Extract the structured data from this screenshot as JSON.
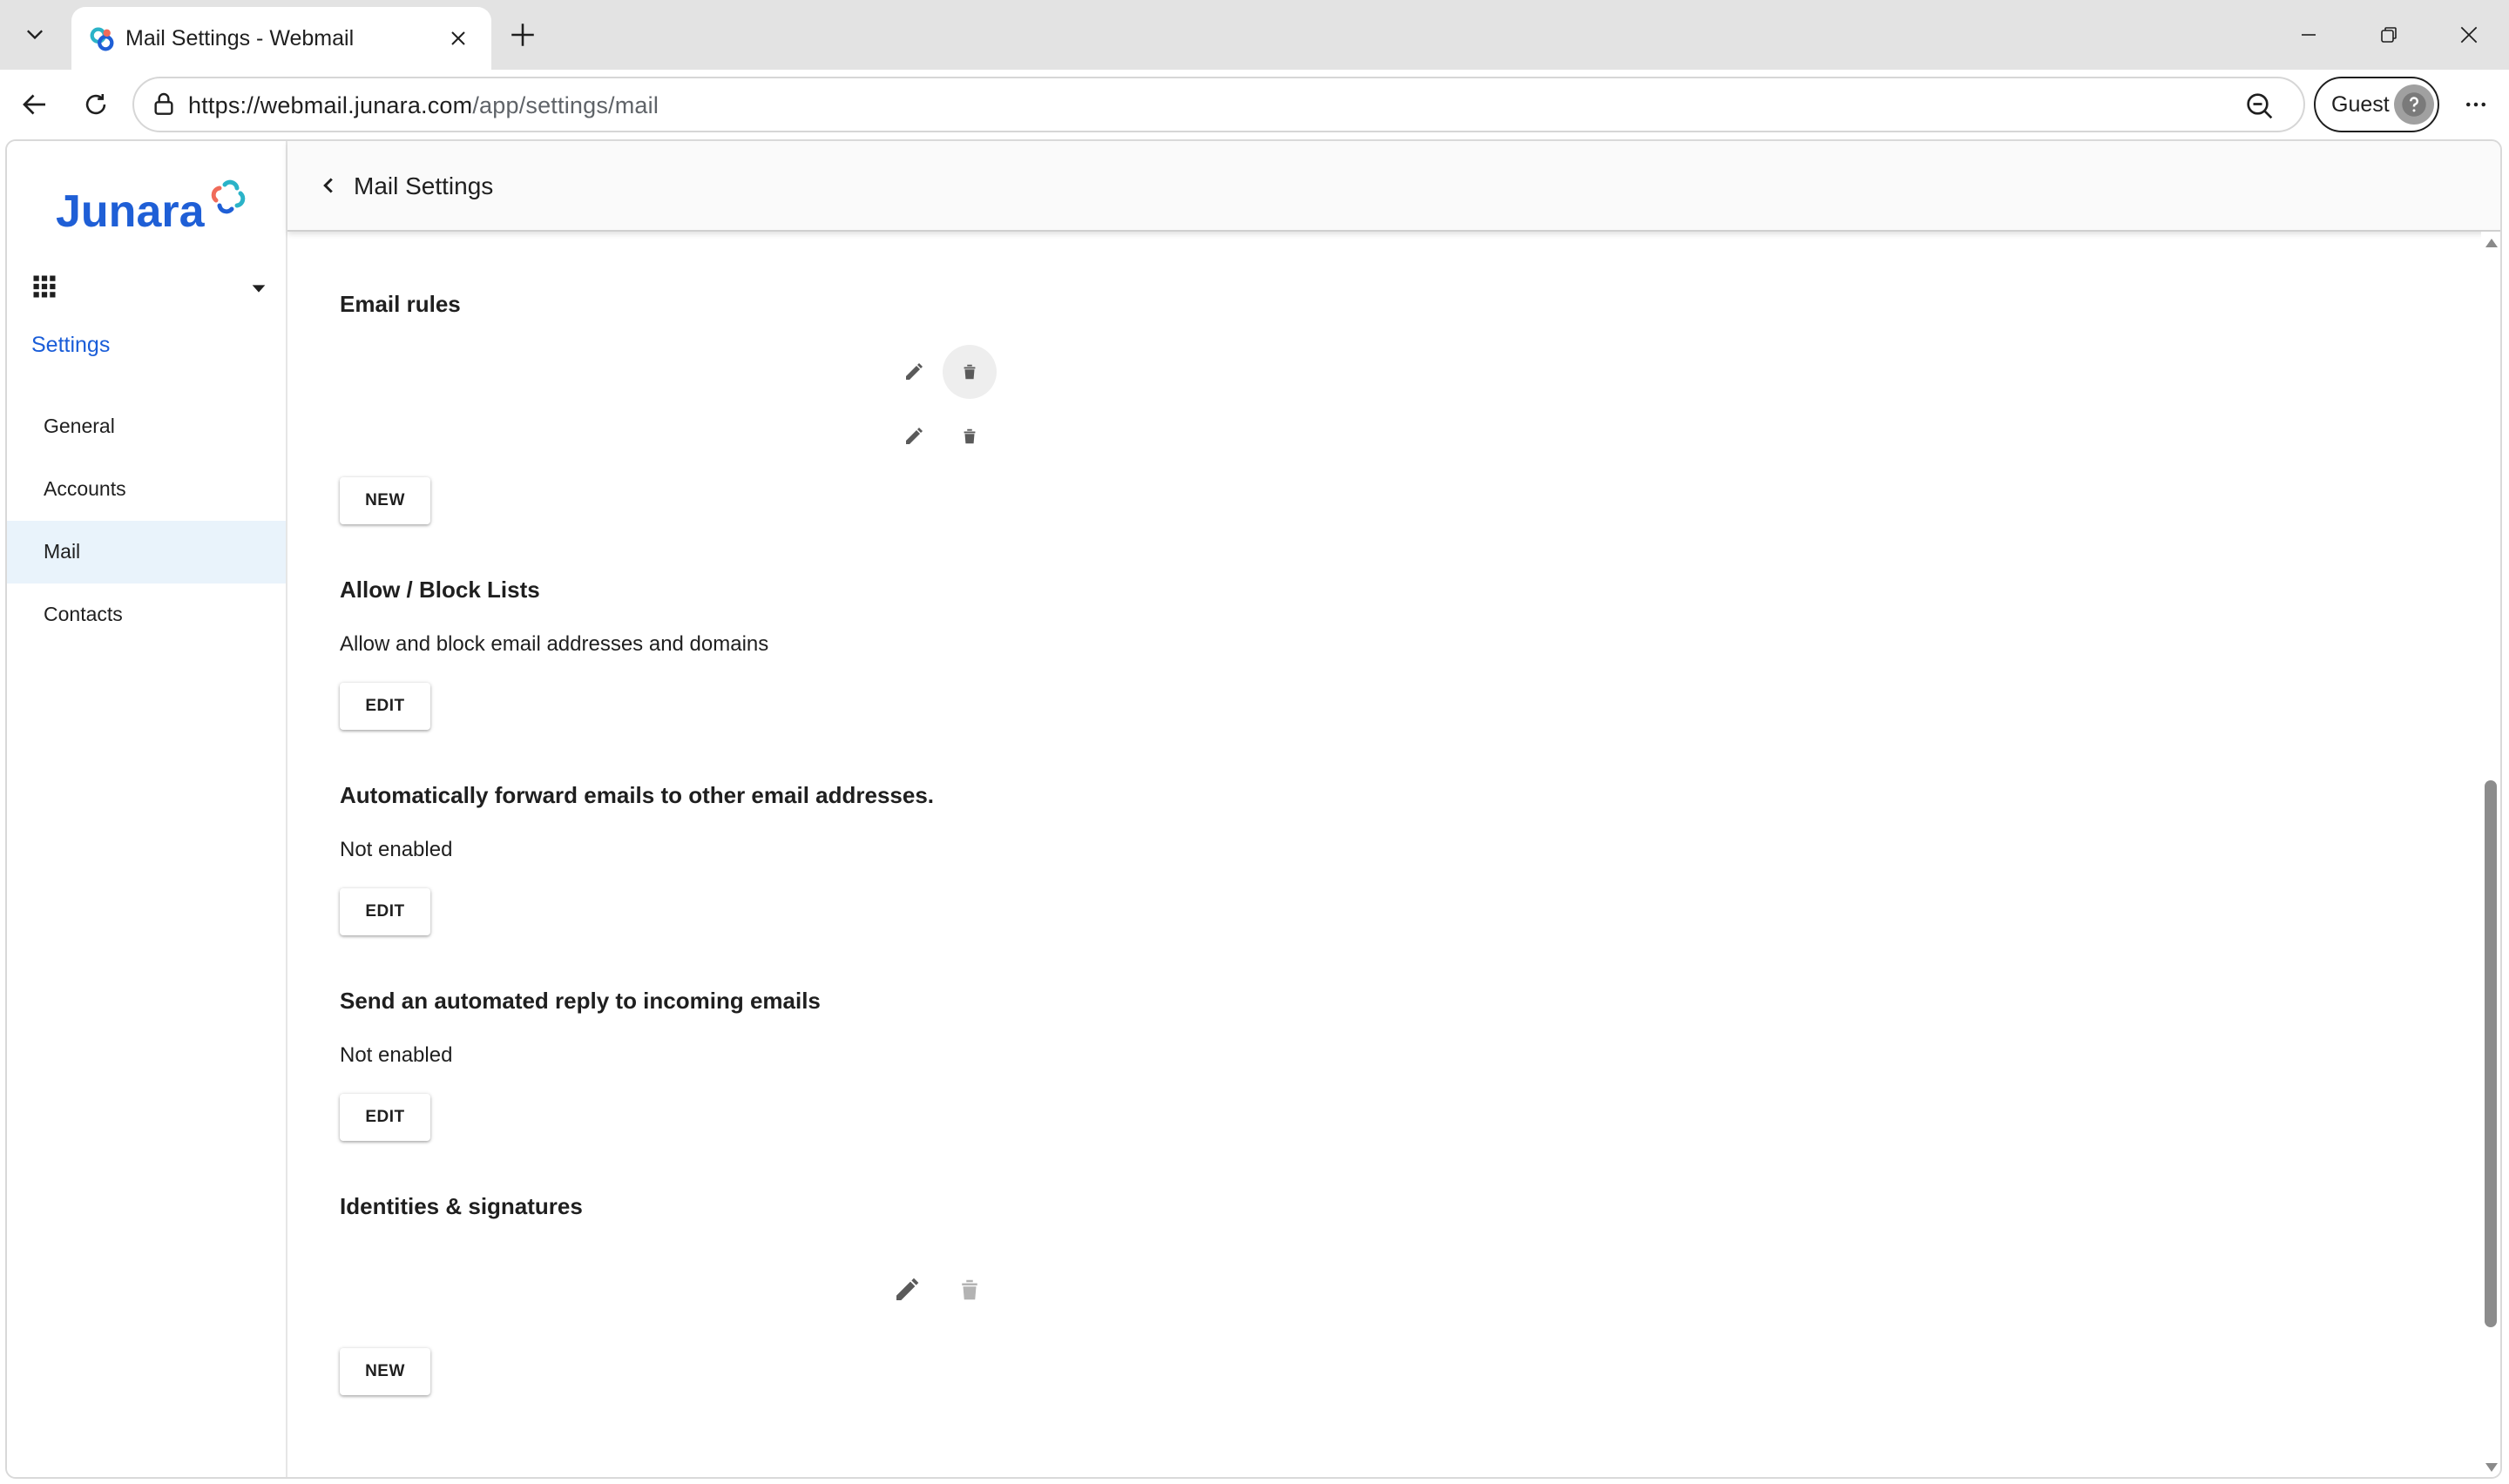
{
  "browser": {
    "tab_title": "Mail Settings - Webmail",
    "url_host": "https://webmail.junara.com",
    "url_path": "/app/settings/mail",
    "profile_label": "Guest"
  },
  "app": {
    "logo_text": "Junara",
    "header_title": "Mail Settings"
  },
  "sidebar": {
    "heading": "Settings",
    "items": [
      {
        "label": "General"
      },
      {
        "label": "Accounts"
      },
      {
        "label": "Mail"
      },
      {
        "label": "Contacts"
      }
    ],
    "active_item": "Mail"
  },
  "sections": {
    "email_rules": {
      "title": "Email rules",
      "button": "NEW"
    },
    "allow_block": {
      "title": "Allow / Block Lists",
      "description": "Allow and block email addresses and domains",
      "button": "EDIT"
    },
    "forward": {
      "title": "Automatically forward emails to other email addresses.",
      "status": "Not enabled",
      "button": "EDIT"
    },
    "auto_reply": {
      "title": "Send an automated reply to incoming emails",
      "status": "Not enabled",
      "button": "EDIT"
    },
    "identities": {
      "title": "Identities & signatures",
      "button": "NEW"
    }
  },
  "colors": {
    "accent": "#1a5dd8",
    "active_nav_bg": "#e9f3fb",
    "logo_blue": "#1f5fd6",
    "logo_teal": "#2bb3c8",
    "logo_coral": "#f06b5a"
  }
}
